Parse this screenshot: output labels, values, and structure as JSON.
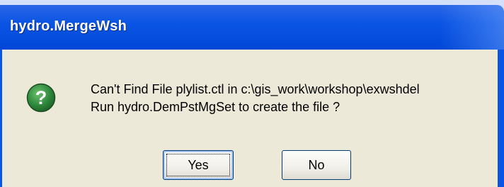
{
  "window": {
    "title": "hydro.MergeWsh"
  },
  "message": {
    "line1": "Can't Find File plylist.ctl in c:\\gis_work\\workshop\\exwshdel",
    "line2": "Run hydro.DemPstMgSet to create the file ?"
  },
  "icon": {
    "name": "question-icon",
    "glyph": "?",
    "color": "#2f8a3c"
  },
  "buttons": {
    "yes_label": "Yes",
    "no_label": "No"
  },
  "colors": {
    "titlebar": "#0b55e4",
    "dialog_bg": "#ede9d8",
    "page_bg": "#d4dffa"
  }
}
